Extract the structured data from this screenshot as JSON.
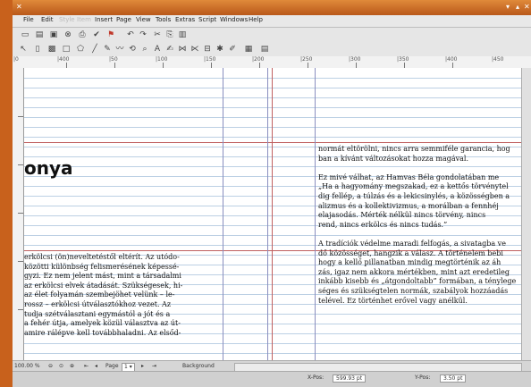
{
  "menu": [
    "File",
    "Edit",
    "Style",
    "Item",
    "Insert",
    "Page",
    "View",
    "Tools",
    "Extras",
    "Script",
    "Windows",
    "Help"
  ],
  "ruler_numbers": [
    "|0",
    "|400",
    "|50",
    "|100",
    "|150",
    "|200",
    "|250",
    "|300",
    "|350",
    "|400",
    "|450"
  ],
  "document": {
    "heading": "onya",
    "left_column": [
      "erkölcsi (ön)neveltetéstől eltérít. Az utódo-",
      "közötti különbség felismerésének képessé-",
      "gyzi. Ez nem jelent mást, mint a társadalmi",
      "az erkölcsi elvek átadását. Szükségesek, hi-",
      "az élet folyamán szembejöhet velünk – le-",
      "rossz – erkölcsi útválasztókhoz vezet. Az",
      "tudja szétválasztani egymástól a jót és a",
      "a fehér útja, amelyek közül választva az út-",
      "amire rálépve kell továbbhaladni. Az elsőd-"
    ],
    "right_column": [
      "normát eltörölni, nincs arra semmiféle garancia, hog",
      "ban a kívánt változásokat hozza magával.",
      "",
      "Ez mivé válhat, az Hamvas Béla gondolatában me",
      "„Ha a hagyomány megszakad, ez a kettős törvénytel",
      "dig fellép, a túlzás és a lekicsinylés, a közösségben a",
      "alizmus és a kollektivizmus, a morálban a fennhéj",
      "elajasodás. Mérték nélkül nincs törvény, nincs",
      "rend, nincs erkölcs és nincs tudás.”",
      "",
      "A tradíciók védelme maradi felfogás, a sivatagba ve",
      "dő közösséget, hangzik a válasz. A történelem bebi",
      "hogy a kellő pillanatban mindig megtörténik az áh",
      "zás, igaz nem akkora mértékben, mint azt eredetileg",
      "inkább kisebb és „átgondoltabb” formában, a ténylege",
      "séges és szükségtelen normák, szabályok hozzáadás",
      "telével. Ez történhet erővel vagy anélkül."
    ]
  },
  "statusbar": {
    "zoom": "100.00 %",
    "page_label": "Page",
    "page_value": "1 ▾",
    "layer": "Background"
  },
  "position": {
    "xpos_label": "X-Pos:",
    "xpos_value": "599.93 pt",
    "ypos_label": "Y-Pos:",
    "ypos_value": "3.50 pt"
  },
  "colors": {
    "accent": "#c8611c",
    "guide": "#8a8fbf",
    "margin_guide": "#c06060",
    "baseline_grid": "#bcd0e4"
  }
}
